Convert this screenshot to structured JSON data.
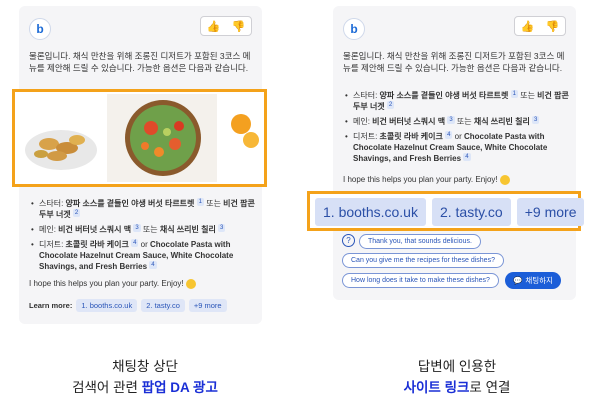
{
  "colors": {
    "highlight_border": "#f4a21a",
    "link_chip_bg": "#dfe6f7",
    "caption_highlight": "#1a2fd6",
    "chat_button": "#1c5ed8"
  },
  "icons": {
    "logo": "bing-b-icon",
    "like": "thumbs-up-icon",
    "dislike": "thumbs-down-icon",
    "help": "question-icon",
    "chat": "chat-bubble-icon"
  },
  "reply": {
    "intro": "물론입니다. 채식 만찬을 위해 조롱진 디저트가 포함된 3코스 메뉴를 제안해 드릴 수 있습니다. 가능한 옵션은 다음과 같습니다.",
    "items": [
      {
        "prefix": "스타터: ",
        "bold": "양파 소스를 곁들인 야생 버섯 타르트렛",
        "sup": "1",
        "middle": " 또는 ",
        "bold2": "비건 팝콘 두부 너겟",
        "sup2": "2"
      },
      {
        "prefix": "메인: ",
        "bold": "비건 버터넛 스쿼시 맥",
        "sup": "3",
        "middle": " 또는 ",
        "bold2": "채식 쓰리빈 칠리",
        "sup2": "3"
      },
      {
        "prefix": "디저트: ",
        "bold": "초콜릿 라바 케이크",
        "sup": "4",
        "middle": " or ",
        "bold2": "Chocolate Pasta with Chocolate Hazelnut Cream Sauce, White Chocolate Shavings, and Fresh Berries",
        "sup2": "4"
      }
    ],
    "closing": "I hope this helps you plan your party. Enjoy!"
  },
  "learn_more": {
    "label": "Learn more:",
    "links": [
      "1. booths.co.uk",
      "2. tasty.co",
      "+9 more"
    ]
  },
  "suggestions": [
    "Thank you, that sounds delicious.",
    "Can you give me the recipes for these dishes?",
    "How long does it take to make these dishes?"
  ],
  "chat_button": "채팅하지",
  "captions": {
    "left_line1": "채팅창 상단",
    "left_line2_plain": "검색어 관련 ",
    "left_line2_highlight": "팝업 DA 광고",
    "right_line1": "답변에 인용한",
    "right_line2_highlight": "사이트 링크",
    "right_line2_plain": "로 연결"
  }
}
